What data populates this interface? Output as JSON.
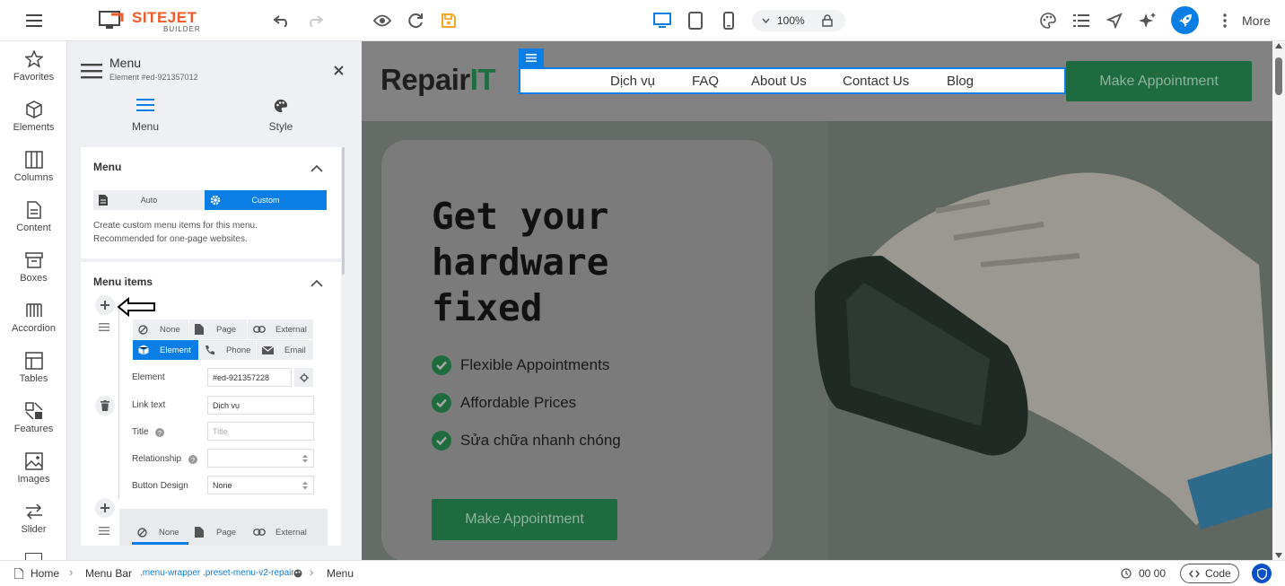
{
  "toolbar": {
    "logo_text": "SITEJET",
    "logo_sub": "BUILDER",
    "zoom": "100%",
    "more_label": "More"
  },
  "sidebar": {
    "items": [
      {
        "label": "Favorites",
        "icon": "star-icon"
      },
      {
        "label": "Elements",
        "icon": "cube-icon"
      },
      {
        "label": "Columns",
        "icon": "columns-icon"
      },
      {
        "label": "Content",
        "icon": "document-icon"
      },
      {
        "label": "Boxes",
        "icon": "box-icon"
      },
      {
        "label": "Accordion",
        "icon": "accordion-icon"
      },
      {
        "label": "Tables",
        "icon": "table-icon"
      },
      {
        "label": "Features",
        "icon": "features-icon"
      },
      {
        "label": "Images",
        "icon": "image-icon"
      },
      {
        "label": "Slider",
        "icon": "slider-icon"
      }
    ]
  },
  "panel": {
    "title": "Menu",
    "subtitle": "Element #ed-921357012",
    "tabs": [
      {
        "label": "Menu"
      },
      {
        "label": "Style"
      }
    ],
    "menu_section": {
      "title": "Menu",
      "mode_auto": "Auto",
      "mode_custom": "Custom",
      "help": "Create custom menu items for this menu. Recommended for one-page websites."
    },
    "items_section": {
      "title": "Menu items",
      "link_types": [
        "None",
        "Page",
        "External",
        "Element",
        "Phone",
        "Email"
      ],
      "element_label": "Element",
      "element_value": "#ed-921357228",
      "link_text_label": "Link text",
      "link_text_value": "Dịch vụ",
      "title_label": "Title",
      "title_placeholder": "Title",
      "relationship_label": "Relationship",
      "relationship_value": "",
      "button_design_label": "Button Design",
      "button_design_value": "None",
      "next_types": [
        "None",
        "Page",
        "External"
      ]
    }
  },
  "site": {
    "brand_a": "Repair",
    "brand_b": "IT",
    "nav": [
      "Dịch vụ",
      "FAQ",
      "About Us",
      "Contact Us",
      "Blog"
    ],
    "header_cta": "Make Appointment",
    "hero_title_1": "Get your",
    "hero_title_2": "hardware",
    "hero_title_3": "fixed",
    "features": [
      "Flexible Appointments",
      "Affordable Prices",
      "Sửa chữa nhanh chóng"
    ],
    "hero_cta": "Make Appointment"
  },
  "breadcrumb": {
    "home": "Home",
    "menubar": "Menu Bar",
    "selector": ".menu-wrapper .preset-menu-v2-repair",
    "current": "Menu",
    "time": "00 00",
    "code_label": "Code"
  },
  "colors": {
    "accent": "#0a7ee4",
    "brand_green": "#2e8b57",
    "logo_orange": "#f05a28"
  }
}
